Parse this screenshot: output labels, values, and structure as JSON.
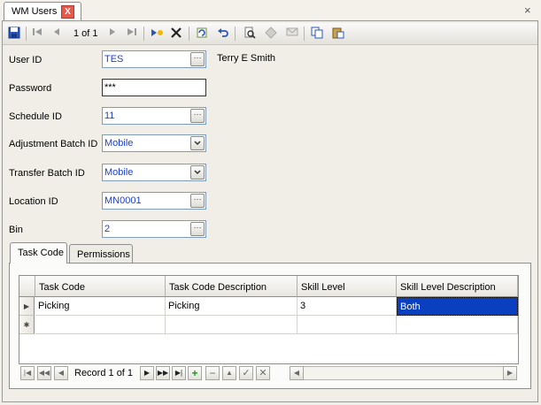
{
  "window": {
    "tab_title": "WM Users",
    "close_glyph": "X",
    "window_close_glyph": "×"
  },
  "toolbar": {
    "position_text": "1 of 1",
    "icons": [
      "save-icon",
      "first-icon",
      "prev-icon",
      "next-icon",
      "last-icon",
      "new-record-icon",
      "delete-icon",
      "refresh-icon",
      "undo-icon",
      "print-preview-icon",
      "tag-icon",
      "email-icon",
      "copy-icon",
      "paste-icon"
    ]
  },
  "form": {
    "user_id": {
      "label": "User ID",
      "value": "TES",
      "name_display": "Terry E Smith"
    },
    "password": {
      "label": "Password",
      "value": "***"
    },
    "schedule_id": {
      "label": "Schedule ID",
      "value": "11"
    },
    "adjustment_batch_id": {
      "label": "Adjustment Batch ID",
      "value": "Mobile"
    },
    "transfer_batch_id": {
      "label": "Transfer Batch ID",
      "value": "Mobile"
    },
    "location_id": {
      "label": "Location ID",
      "value": "MN0001"
    },
    "bin": {
      "label": "Bin",
      "value": "2"
    },
    "ellipsis": "···"
  },
  "tabs": [
    {
      "label": "Task Code",
      "active": true
    },
    {
      "label": "Permissions",
      "active": false
    }
  ],
  "grid": {
    "columns": [
      "Task Code",
      "Task Code Description",
      "Skill Level",
      "Skill Level Description"
    ],
    "rows": [
      {
        "task_code": "Picking",
        "task_code_description": "Picking",
        "skill_level": "3",
        "skill_level_description": "Both"
      }
    ],
    "current_row_glyph": "▶",
    "new_row_glyph": "✱"
  },
  "navigator": {
    "record_text": "Record 1 of 1",
    "buttons": [
      "first",
      "prev-page",
      "prev",
      "next",
      "next-page",
      "last",
      "add",
      "remove",
      "up",
      "accept",
      "cancel"
    ]
  }
}
